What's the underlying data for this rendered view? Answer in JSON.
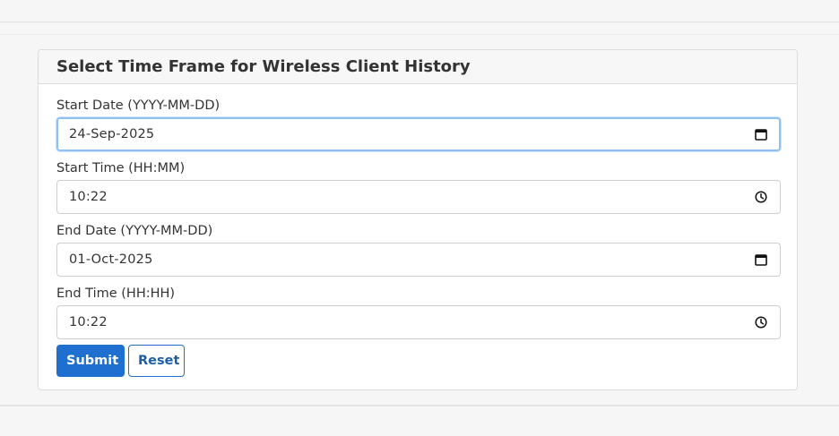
{
  "card": {
    "title": "Select Time Frame for Wireless Client History"
  },
  "form": {
    "start_date": {
      "label": "Start Date (YYYY-MM-DD)",
      "value": "24-Sep-2025",
      "icon": "calendar-icon"
    },
    "start_time": {
      "label": "Start Time (HH:MM)",
      "value": "10:22",
      "icon": "clock-icon"
    },
    "end_date": {
      "label": "End Date (YYYY-MM-DD)",
      "value": "01-Oct-2025",
      "icon": "calendar-icon"
    },
    "end_time": {
      "label": "End Time (HH:HH)",
      "value": "10:22",
      "icon": "clock-icon"
    }
  },
  "buttons": {
    "submit_label": "Submit",
    "reset_label": "Reset"
  },
  "colors": {
    "primary": "#1e6fd0",
    "focus_ring": "#8ec0f5"
  }
}
